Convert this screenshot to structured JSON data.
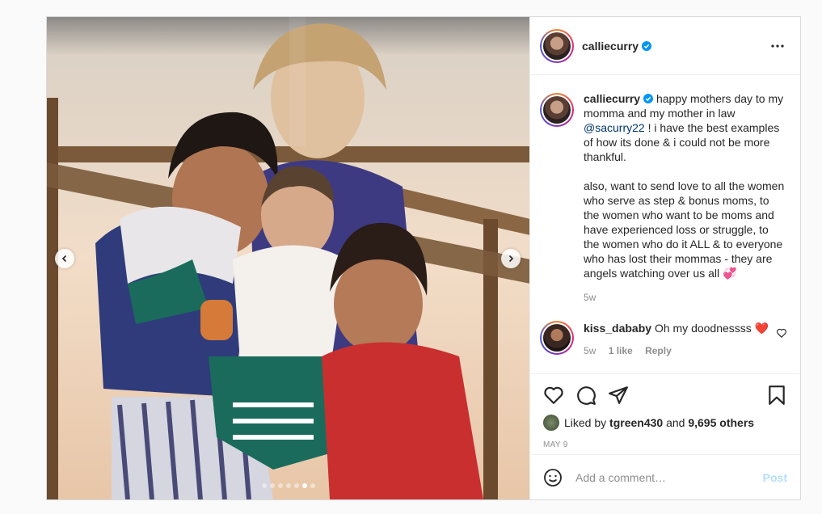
{
  "post": {
    "username": "calliecurry",
    "more_icon": "more-horizontal-icon",
    "carousel": {
      "total": 7,
      "active_index": 5
    },
    "caption": {
      "username": "calliecurry",
      "text_1": "happy mothers day to my momma and my mother in law",
      "mention": "@sacurry22",
      "text_2": "! i have the best examples of how its done & i could not be more thankful.",
      "paragraph_2": "also, want to send love to all the women who serve as step & bonus moms, to the women who want to be moms and have experienced loss or struggle, to the women who do it ALL & to everyone who has lost their mommas - they are angels watching over us all 💞",
      "time": "5w"
    },
    "comments": [
      {
        "username": "kiss_dababy",
        "text": "Oh my doodnessss ❤️",
        "time": "5w",
        "likes": "1 like",
        "reply": "Reply"
      }
    ],
    "liked_by": {
      "prefix": "Liked by",
      "user": "tgreen430",
      "middle": "and",
      "count": "9,695 others"
    },
    "date": "MAY 9",
    "add_comment": {
      "placeholder": "Add a comment…",
      "post_label": "Post"
    }
  },
  "colors": {
    "verified": "#0095f6",
    "mention": "#00376b",
    "post_disabled": "#b2dffc",
    "heart": "#ed4956"
  }
}
